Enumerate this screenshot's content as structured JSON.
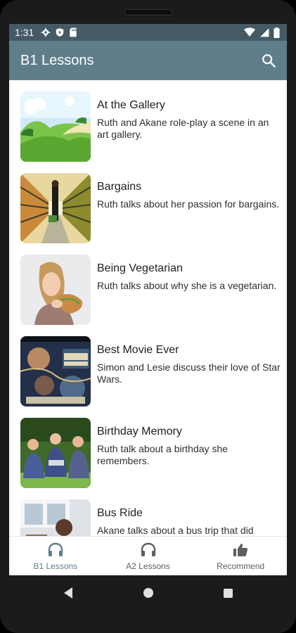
{
  "status_bar": {
    "time": "1:31",
    "left_icons": [
      "settings-icon",
      "shield-icon",
      "sd-card-icon"
    ],
    "right_icons": [
      "wifi-icon",
      "signal-icon",
      "battery-icon"
    ]
  },
  "app_bar": {
    "title": "B1 Lessons",
    "search_icon": "search-icon",
    "background": "#607d8b"
  },
  "lessons": [
    {
      "title": "At the Gallery",
      "description": "Ruth and Akane role-play a scene in an art gallery.",
      "thumbnail": "green hills landscape"
    },
    {
      "title": "Bargains",
      "description": "Ruth talks about her passion for bargains.",
      "thumbnail": "supermarket aisle"
    },
    {
      "title": "Being Vegetarian",
      "description": "Ruth talks about why she is a vegetarian.",
      "thumbnail": "girl eating sandwich"
    },
    {
      "title": "Best Movie Ever",
      "description": "Simon and Lesie discuss their love of Star Wars.",
      "thumbnail": "movie poster"
    },
    {
      "title": "Birthday Memory",
      "description": "Ruth talk about a birthday she remembers.",
      "thumbnail": "children sitting on grass"
    },
    {
      "title": "Bus Ride",
      "description": "Akane talks about a bus trip that did",
      "thumbnail": "bus interior"
    }
  ],
  "bottom_nav": {
    "items": [
      {
        "label": "B1 Lessons",
        "icon": "headphones-icon",
        "active": true
      },
      {
        "label": "A2 Lessons",
        "icon": "headphones-icon",
        "active": false
      },
      {
        "label": "Recommend",
        "icon": "thumbs-up-icon",
        "active": false
      }
    ]
  },
  "system_nav": [
    "back-icon",
    "home-icon",
    "recents-icon"
  ]
}
